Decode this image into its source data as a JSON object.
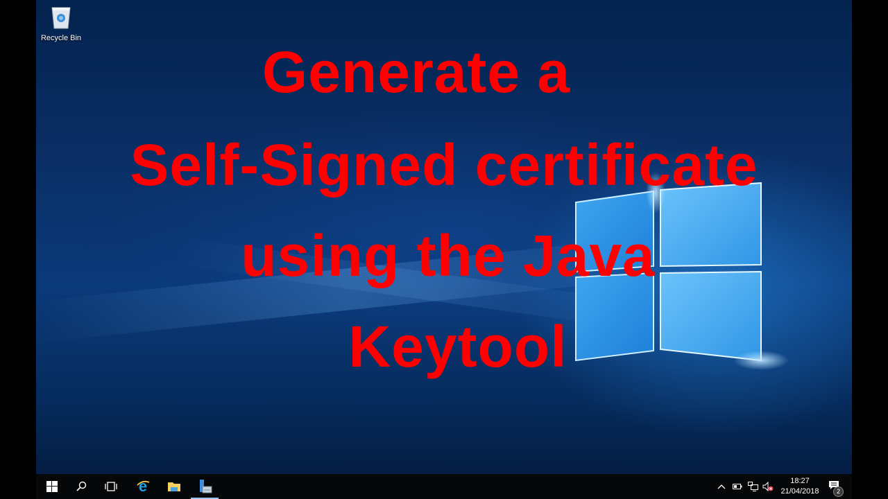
{
  "desktop": {
    "icons": [
      {
        "label": "Recycle Bin",
        "icon": "recycle-bin-icon"
      }
    ],
    "wallpaper": "windows-10-hero",
    "overlay_title": {
      "lines": [
        "Generate a",
        "Self-Signed certificate",
        "using the Java",
        "Keytool"
      ],
      "color": "#ff0000"
    }
  },
  "taskbar": {
    "buttons": [
      {
        "name": "start",
        "icon": "windows-start-icon"
      },
      {
        "name": "search",
        "icon": "search-icon"
      },
      {
        "name": "task-view",
        "icon": "task-view-icon"
      },
      {
        "name": "internet-explorer",
        "icon": "internet-explorer-icon"
      },
      {
        "name": "file-explorer",
        "icon": "folder-icon"
      },
      {
        "name": "server-manager",
        "icon": "server-manager-icon",
        "active": true
      }
    ],
    "tray": {
      "icons": [
        "chevron-up-icon",
        "battery-icon",
        "network-icon",
        "volume-muted-icon"
      ],
      "time": "18:27",
      "date": "21/04/2018",
      "notifications_count": "2"
    }
  }
}
